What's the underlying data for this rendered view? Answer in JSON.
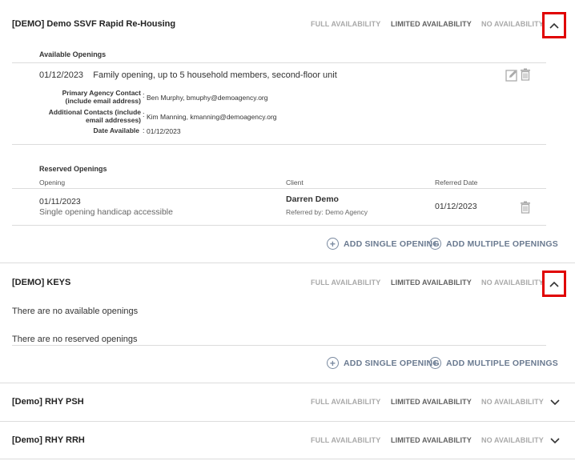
{
  "availability_labels": {
    "full": "FULL AVAILABILITY",
    "limited": "LIMITED AVAILABILITY",
    "none": "NO AVAILABILITY"
  },
  "programs": [
    {
      "title": "[DEMO] Demo SSVF Rapid Re-Housing",
      "expanded": true,
      "available_openings_label": "Available Openings",
      "available_opening": {
        "summary": "01/12/2023    Family opening, up to 5 household members, second-floor unit",
        "primary_contact_label_1": "Primary Agency Contact",
        "primary_contact_label_2": "(include email address)",
        "primary_contact_value": "Ben Murphy, bmuphy@demoagency.org",
        "additional_contacts_label_1": "Additional Contacts (include",
        "additional_contacts_label_2": "email addresses)",
        "additional_contacts_value": "Kim Manning, kmanning@demoagency.org",
        "date_available_label": "Date Available",
        "date_available_value": "01/12/2023"
      },
      "reserved_openings_label": "Reserved Openings",
      "reserved_columns": {
        "opening": "Opening",
        "client": "Client",
        "referred_date": "Referred Date"
      },
      "reserved_row": {
        "opening_date": "01/11/2023",
        "opening_desc": "Single opening handicap accessible",
        "client_name": "Darren Demo",
        "referred_by": "Referred by: Demo Agency",
        "referred_date": "01/12/2023"
      },
      "add_single_label": "ADD SINGLE OPENING",
      "add_multiple_label": "ADD MULTIPLE OPENINGS"
    },
    {
      "title": "[DEMO] KEYS",
      "expanded": true,
      "no_available": "There are no available openings",
      "no_reserved": "There are no reserved openings",
      "add_single_label": "ADD SINGLE OPENING",
      "add_multiple_label": "ADD MULTIPLE OPENINGS"
    },
    {
      "title": "[Demo] RHY PSH",
      "expanded": false
    },
    {
      "title": "[Demo] RHY RRH",
      "expanded": false
    }
  ]
}
